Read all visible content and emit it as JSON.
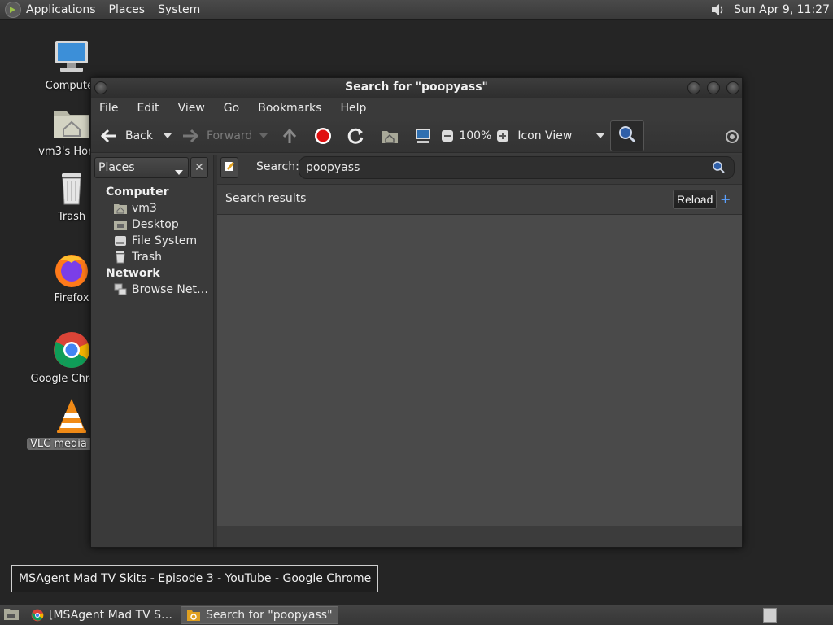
{
  "top_panel": {
    "menu": [
      "Applications",
      "Places",
      "System"
    ],
    "clock": "Sun Apr  9, 11:27"
  },
  "desktop_icons": [
    {
      "label": "Computer",
      "icon": "computer-icon"
    },
    {
      "label": "vm3's Home",
      "icon": "home-folder-icon"
    },
    {
      "label": "Trash",
      "icon": "trash-icon"
    },
    {
      "label": "Firefox",
      "icon": "firefox-icon"
    },
    {
      "label": "Google Chrome",
      "icon": "chrome-icon"
    },
    {
      "label": "VLC media player",
      "icon": "vlc-icon"
    }
  ],
  "window": {
    "title": "Search for \"poopyass\"",
    "menu": [
      "File",
      "Edit",
      "View",
      "Go",
      "Bookmarks",
      "Help"
    ],
    "toolbar": {
      "back": "Back",
      "forward": "Forward",
      "zoom": "100%",
      "view_mode": "Icon View"
    },
    "sidebar": {
      "selector": "Places",
      "sections": [
        {
          "heading": "Computer",
          "items": [
            {
              "label": "vm3",
              "icon": "home-icon"
            },
            {
              "label": "Desktop",
              "icon": "desktop-folder-icon"
            },
            {
              "label": "File System",
              "icon": "drive-icon"
            },
            {
              "label": "Trash",
              "icon": "trash-icon"
            }
          ]
        },
        {
          "heading": "Network",
          "items": [
            {
              "label": "Browse Net…",
              "icon": "network-icon"
            }
          ]
        }
      ]
    },
    "search": {
      "label": "Search:",
      "value": "poopyass"
    },
    "results": {
      "title": "Search results",
      "reload": "Reload",
      "add": "+"
    }
  },
  "tooltip": "MSAgent Mad TV Skits - Episode 3 - YouTube - Google Chrome",
  "taskbar": {
    "tasks": [
      {
        "label": "[MSAgent Mad TV S…",
        "icon": "chrome-icon",
        "active": false
      },
      {
        "label": "Search for \"poopyass\"",
        "icon": "search-folder-icon",
        "active": true
      }
    ]
  },
  "colors": {
    "panel": "#3a3a3a",
    "desktop": "#252525",
    "content": "#4a4a4a",
    "stop_red": "#e01010",
    "accent_blue": "#5aa0ff"
  }
}
